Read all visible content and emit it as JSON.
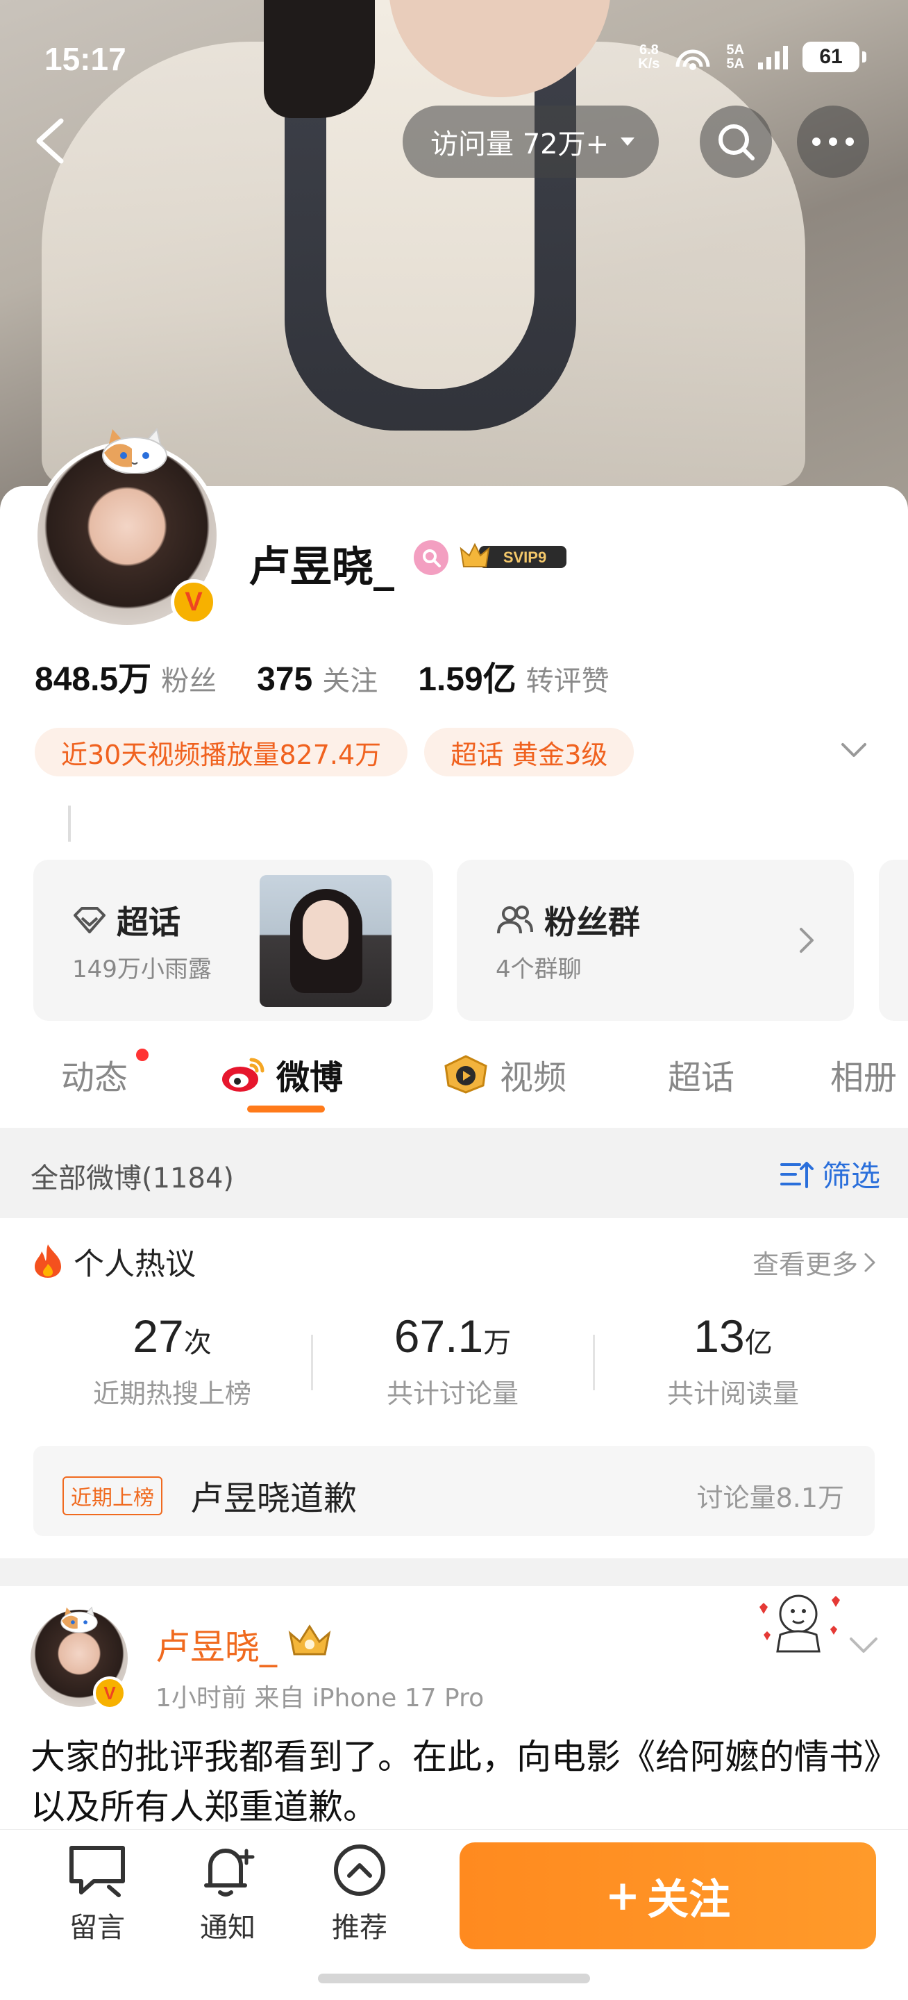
{
  "status_bar": {
    "time": "15:17",
    "net_speed_value": "6.8",
    "net_speed_unit": "K/s",
    "signal_label": "5A",
    "signal_label2": "5A",
    "battery": "61"
  },
  "top_nav": {
    "visits_label": "访问量 72万+"
  },
  "profile": {
    "name": "卢昱晓_",
    "svip_label": "SVIP9",
    "stats": [
      {
        "value": "848.5万",
        "label": "粉丝"
      },
      {
        "value": "375",
        "label": "关注"
      },
      {
        "value": "1.59亿",
        "label": "转评赞"
      }
    ],
    "tags": [
      "近30天视频播放量827.4万",
      "超话 黄金3级"
    ]
  },
  "feature_cards": {
    "supertopic": {
      "title": "超话",
      "sub": "149万小雨露"
    },
    "fangroup": {
      "title": "粉丝群",
      "sub": "4个群聊"
    }
  },
  "tabs": [
    {
      "label": "动态"
    },
    {
      "label": "微博"
    },
    {
      "label": "视频"
    },
    {
      "label": "超话"
    },
    {
      "label": "相册"
    }
  ],
  "filter_bar": {
    "all_label": "全部微博(1184)",
    "filter_label": "筛选"
  },
  "hot_discussion": {
    "title": "个人热议",
    "more_label": "查看更多",
    "metrics": [
      {
        "value": "27",
        "unit": "次",
        "label": "近期热搜上榜"
      },
      {
        "value": "67.1",
        "unit": "万",
        "label": "共计讨论量"
      },
      {
        "value": "13",
        "unit": "亿",
        "label": "共计阅读量"
      }
    ],
    "row": {
      "badge": "近期上榜",
      "topic": "卢昱晓道歉",
      "count": "讨论量8.1万"
    }
  },
  "post": {
    "name": "卢昱晓_",
    "meta": "1小时前   来自 iPhone 17 Pro",
    "text": "大家的批评我都看到了。在此，向电影《给阿嬷的情书》以及所有人郑重道歉。"
  },
  "bottom_bar": {
    "comment_label": "留言",
    "notify_label": "通知",
    "recommend_label": "推荐",
    "follow_label": "关注",
    "follow_plus": "+"
  },
  "colors": {
    "accent": "#ff7a1a",
    "name_orange": "#f06a1f",
    "filter_blue": "#2a6fdb"
  }
}
